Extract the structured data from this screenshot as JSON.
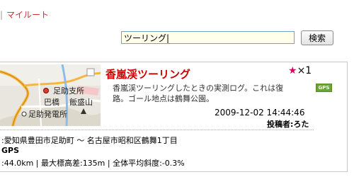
{
  "breadcrumb": {
    "separator": "|",
    "item": "マイルート"
  },
  "search": {
    "value": "ツーリング|",
    "placeholder": "",
    "button_label": "検索"
  },
  "result": {
    "title": "香嵐渓ツーリング",
    "favorite_count": "×1",
    "description": "香嵐渓ツーリングしたときの実測ログ。これは復路。ゴール地点は鶴舞公園。",
    "gps_badge": "GPS",
    "date": "2009-12-02 14:44:46",
    "poster_label": "投稿者:",
    "poster_name": "ろた",
    "route_text": ":愛知県豊田市足助町 〜 名古屋市昭和区鶴舞1丁目",
    "gps_text": "GPS",
    "stats_text": ":44.0km | 最大標高差:135m | 全体平均斜度:-0.3%"
  },
  "map": {
    "labels": [
      "足助支所",
      "巴橋",
      "飯盛山",
      "足助発電所"
    ],
    "colors": {
      "road": "#f6b63b",
      "land": "#e9e6df",
      "water": "#8fbce6"
    }
  },
  "colors": {
    "accent": "#cc0000",
    "star": "#e0006c",
    "gps": "#6aa336"
  }
}
